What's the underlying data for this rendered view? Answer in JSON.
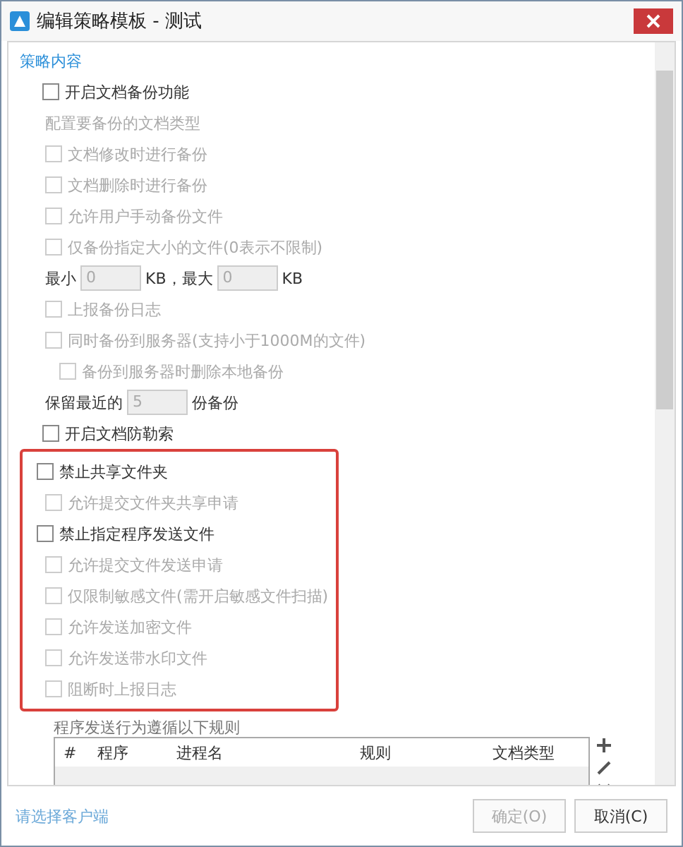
{
  "window": {
    "title": "编辑策略模板 - 测试"
  },
  "section_title": "策略内容",
  "groups": [
    {
      "highlighted": false,
      "items": [
        {
          "kind": "checkbox",
          "label": "开启文档备份功能",
          "checked": false,
          "disabled": false,
          "children": [
            {
              "kind": "label",
              "label": "配置要备份的文档类型",
              "disabled": true
            },
            {
              "kind": "checkbox",
              "label": "文档修改时进行备份",
              "checked": false,
              "disabled": true
            },
            {
              "kind": "checkbox",
              "label": "文档删除时进行备份",
              "checked": false,
              "disabled": true
            },
            {
              "kind": "checkbox",
              "label": "允许用户手动备份文件",
              "checked": false,
              "disabled": true
            },
            {
              "kind": "checkbox",
              "label": "仅备份指定大小的文件(0表示不限制)",
              "checked": false,
              "disabled": true
            },
            {
              "kind": "fields",
              "parts": [
                {
                  "text": "最小"
                },
                {
                  "value": "0"
                },
                {
                  "text": "KB，最大"
                },
                {
                  "value": "0"
                },
                {
                  "text": "KB"
                }
              ]
            },
            {
              "kind": "checkbox",
              "label": "上报备份日志",
              "checked": false,
              "disabled": true
            },
            {
              "kind": "checkbox",
              "label": "同时备份到服务器(支持小于1000M的文件)",
              "checked": false,
              "disabled": true,
              "children": [
                {
                  "kind": "checkbox",
                  "label": "备份到服务器时删除本地备份",
                  "checked": false,
                  "disabled": true
                }
              ]
            },
            {
              "kind": "fields",
              "parts": [
                {
                  "text": "保留最近的"
                },
                {
                  "value": "5"
                },
                {
                  "text": "份备份"
                }
              ]
            }
          ]
        },
        {
          "kind": "checkbox",
          "label": "开启文档防勒索",
          "checked": false,
          "disabled": false
        }
      ]
    },
    {
      "highlighted": true,
      "items": [
        {
          "kind": "checkbox",
          "label": "禁止共享文件夹",
          "checked": false,
          "disabled": false,
          "children": [
            {
              "kind": "checkbox",
              "label": "允许提交文件夹共享申请",
              "checked": false,
              "disabled": true
            }
          ]
        },
        {
          "kind": "checkbox",
          "label": "禁止指定程序发送文件",
          "checked": false,
          "disabled": false,
          "children": [
            {
              "kind": "checkbox",
              "label": "允许提交文件发送申请",
              "checked": false,
              "disabled": true
            },
            {
              "kind": "checkbox",
              "label": "仅限制敏感文件(需开启敏感文件扫描)",
              "checked": false,
              "disabled": true
            },
            {
              "kind": "checkbox",
              "label": "允许发送加密文件",
              "checked": false,
              "disabled": true
            },
            {
              "kind": "checkbox",
              "label": "允许发送带水印文件",
              "checked": false,
              "disabled": true
            },
            {
              "kind": "checkbox",
              "label": "阻断时上报日志",
              "checked": false,
              "disabled": true
            }
          ]
        }
      ]
    }
  ],
  "rules": {
    "caption": "程序发送行为遵循以下规则",
    "columns": [
      "#",
      "程序",
      "进程名",
      "规则",
      "文档类型"
    ]
  },
  "footer": {
    "link": "请选择客户端",
    "buttons": [
      {
        "label": "确定(O)",
        "disabled": true
      },
      {
        "label": "取消(C)",
        "disabled": false
      }
    ]
  }
}
